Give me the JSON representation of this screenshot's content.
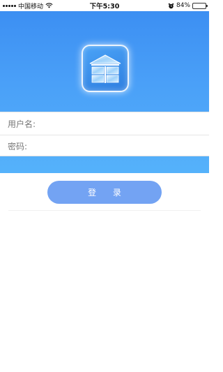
{
  "status_bar": {
    "carrier": "中国移动",
    "time": "下午5:30",
    "battery_percent": "84%",
    "battery_level": 0.84,
    "icons": [
      "signal-icon",
      "wifi-icon",
      "alarm-icon",
      "battery-icon"
    ]
  },
  "header": {
    "logo_icon": "warehouse-icon",
    "background_color": "#4a9ef7"
  },
  "form": {
    "username_label": "用户名:",
    "username_value": "",
    "password_label": "密码:",
    "password_value": ""
  },
  "actions": {
    "login_label": "登 录",
    "login_color": "#73a3f3"
  }
}
